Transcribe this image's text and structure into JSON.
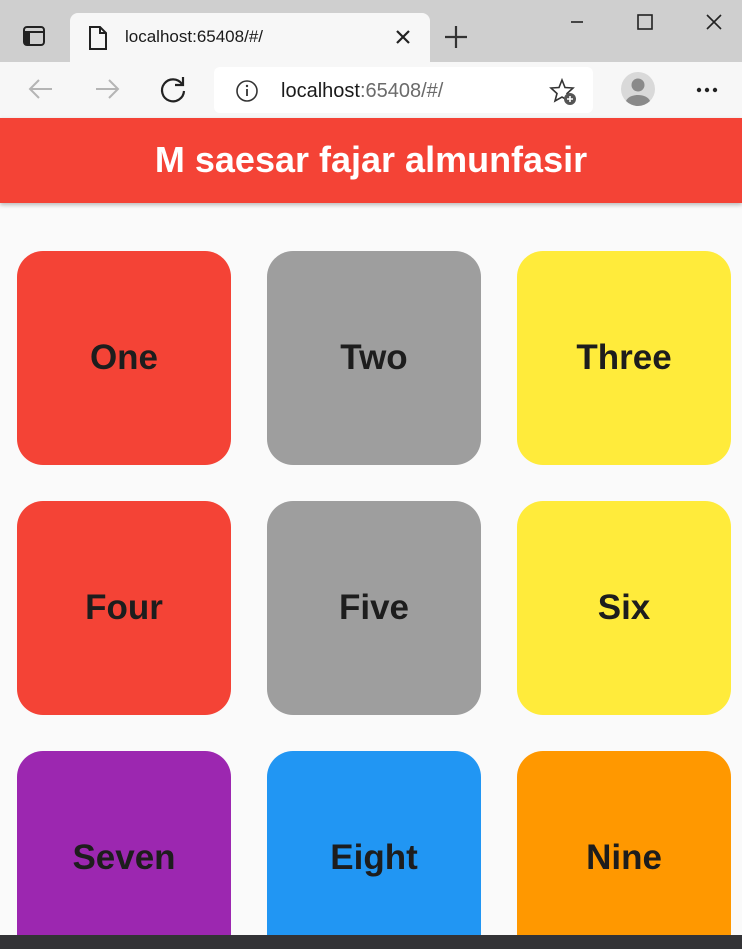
{
  "browser": {
    "tab_title": "localhost:65408/#/",
    "url_host": "localhost",
    "url_rest": ":65408/#/"
  },
  "app": {
    "title": "M saesar fajar almunfasir"
  },
  "tiles": [
    {
      "label": "One",
      "color": "#f44336"
    },
    {
      "label": "Two",
      "color": "#9e9e9e"
    },
    {
      "label": "Three",
      "color": "#ffeb3b"
    },
    {
      "label": "Four",
      "color": "#f44336"
    },
    {
      "label": "Five",
      "color": "#9e9e9e"
    },
    {
      "label": "Six",
      "color": "#ffeb3b"
    },
    {
      "label": "Seven",
      "color": "#9c27b0"
    },
    {
      "label": "Eight",
      "color": "#2196f3"
    },
    {
      "label": "Nine",
      "color": "#ff9800"
    }
  ],
  "icons": {
    "tab_actions": "tab-actions-icon",
    "page": "page-icon",
    "close_tab": "close-icon",
    "new_tab": "plus-icon",
    "back": "back-arrow-icon",
    "forward": "forward-arrow-icon",
    "refresh": "refresh-icon",
    "site_info": "info-icon",
    "favorites": "star-add-icon",
    "profile": "profile-icon",
    "menu": "more-icon"
  }
}
